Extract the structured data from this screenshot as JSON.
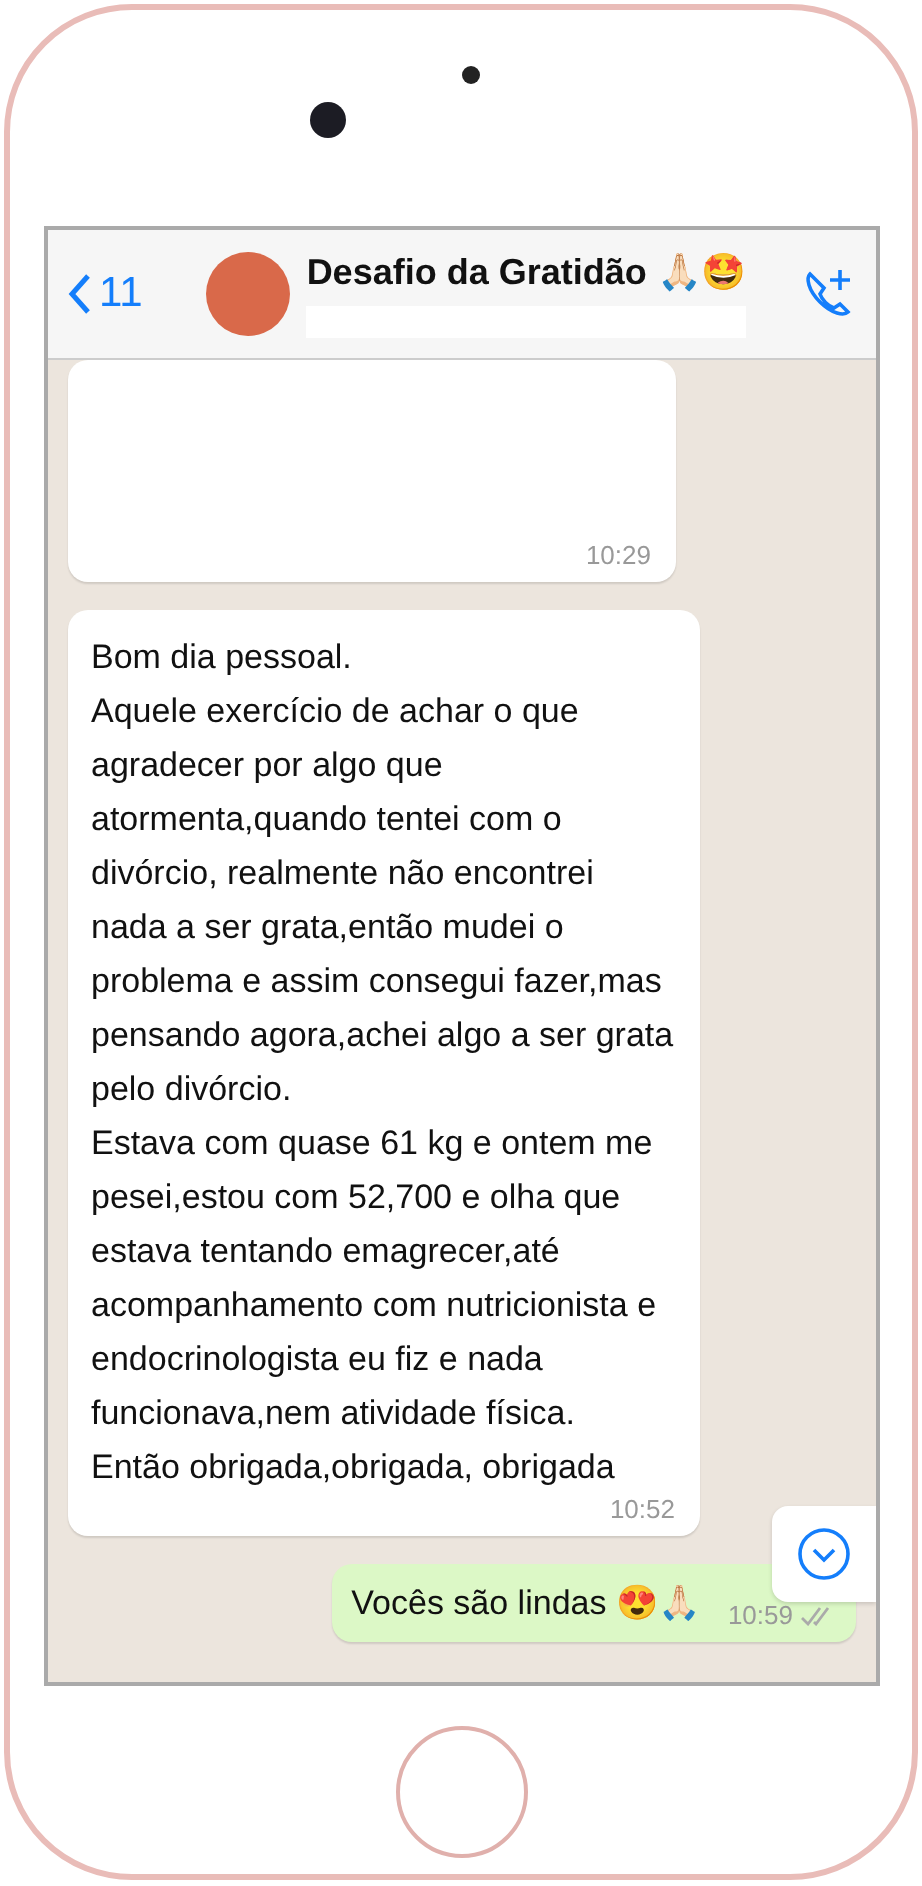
{
  "header": {
    "back_count": "11",
    "title": "Desafio da Gratidão 🙏🏻🤩"
  },
  "messages": [
    {
      "kind": "incoming",
      "time": "10:29"
    },
    {
      "kind": "incoming",
      "text": "Bom dia pessoal.\nAquele exercício de achar o que agradecer por algo que atormenta,quando tentei com o divórcio, realmente não encontrei nada a ser grata,então mudei o problema e assim consegui fazer,mas pensando agora,achei algo a ser grata pelo divórcio.\nEstava com quase 61 kg e ontem me pesei,estou com 52,700 e olha que estava tentando emagrecer,até acompanhamento com nutricionista e endocrinologista eu fiz e nada funcionava,nem atividade física.\nEntão obrigada,obrigada, obrigada",
      "time": "10:52"
    },
    {
      "kind": "outgoing",
      "text": "Vocês são lindas 😍🙏🏻",
      "time": "10:59"
    }
  ]
}
